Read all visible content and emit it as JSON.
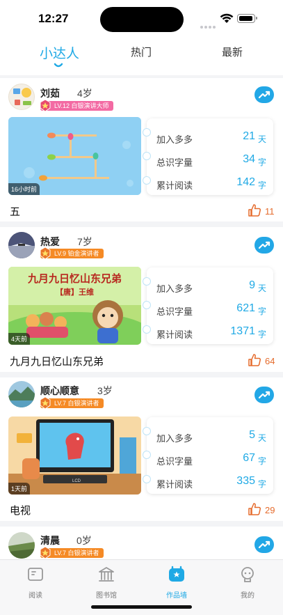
{
  "status": {
    "time": "12:27"
  },
  "tabs": [
    {
      "label": "小达人",
      "active": true
    },
    {
      "label": "热门",
      "active": false
    },
    {
      "label": "最新",
      "active": false
    }
  ],
  "posts": [
    {
      "name": "刘茹",
      "age": "4岁",
      "badge": "LV.12 白银演讲大师",
      "badge_color": "#f36aa3",
      "ago": "16小时前",
      "title": "五",
      "likes": "11",
      "stats": [
        {
          "label": "加入多多",
          "value": "21",
          "unit": "天"
        },
        {
          "label": "总识字量",
          "value": "34",
          "unit": "字"
        },
        {
          "label": "累计阅读",
          "value": "142",
          "unit": "字"
        }
      ]
    },
    {
      "name": "热爱",
      "age": "7岁",
      "badge": "LV.9 铂金演讲者",
      "badge_color": "#f58a25",
      "ago": "4天前",
      "title": "九月九日忆山东兄弟",
      "likes": "64",
      "thumb_title": "九月九日忆山东兄弟",
      "thumb_sub": "【唐】王维",
      "stats": [
        {
          "label": "加入多多",
          "value": "9",
          "unit": "天"
        },
        {
          "label": "总识字量",
          "value": "621",
          "unit": "字"
        },
        {
          "label": "累计阅读",
          "value": "1371",
          "unit": "字"
        }
      ]
    },
    {
      "name": "顺心顺意",
      "age": "3岁",
      "badge": "LV.7 白银演讲者",
      "badge_color": "#f58a25",
      "ago": "1天前",
      "title": "电视",
      "likes": "29",
      "tv_brand": "LCD",
      "stats": [
        {
          "label": "加入多多",
          "value": "5",
          "unit": "天"
        },
        {
          "label": "总识字量",
          "value": "67",
          "unit": "字"
        },
        {
          "label": "累计阅读",
          "value": "335",
          "unit": "字"
        }
      ]
    },
    {
      "name": "清晨",
      "age": "0岁",
      "badge": "LV.7 白银演讲者",
      "badge_color": "#f58a25"
    }
  ],
  "bottom_nav": [
    {
      "label": "阅读",
      "icon": "book-icon",
      "active": false
    },
    {
      "label": "图书馆",
      "icon": "library-icon",
      "active": false
    },
    {
      "label": "作品墙",
      "icon": "works-wall-icon",
      "active": true
    },
    {
      "label": "我的",
      "icon": "profile-icon",
      "active": false
    }
  ],
  "colors": {
    "accent": "#1fa9e5",
    "like": "#e56b2c"
  }
}
